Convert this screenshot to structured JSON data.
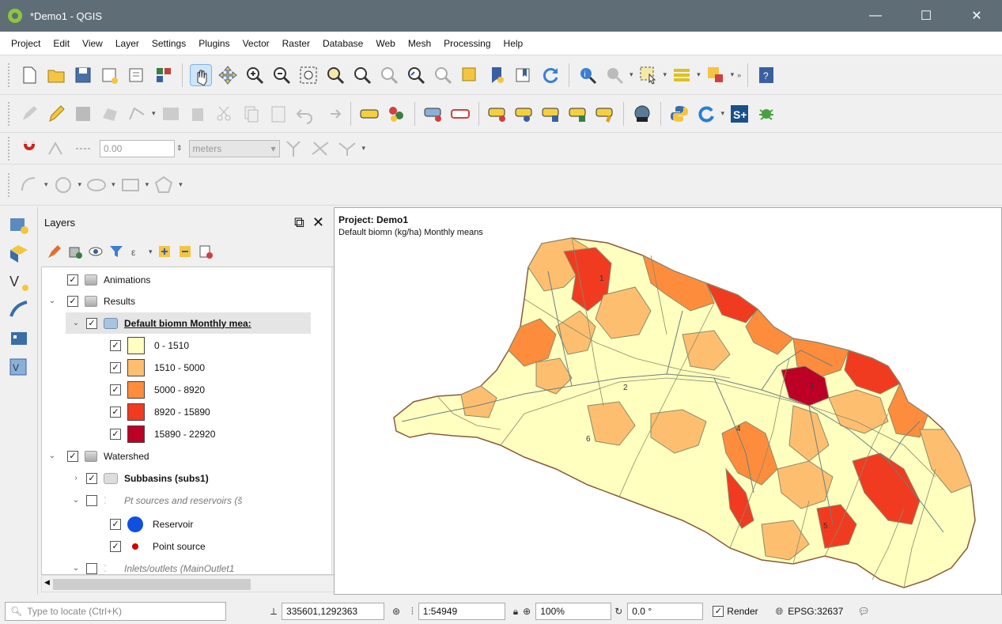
{
  "window": {
    "title": "*Demo1 - QGIS",
    "controls": [
      "—",
      "☐",
      "✕"
    ]
  },
  "menu": [
    "Project",
    "Edit",
    "View",
    "Layer",
    "Settings",
    "Plugins",
    "Vector",
    "Raster",
    "Database",
    "Web",
    "Mesh",
    "Processing",
    "Help"
  ],
  "snapping": {
    "tolerance": "0.00",
    "units": "meters"
  },
  "layers_panel": {
    "title": "Layers",
    "items": [
      {
        "label": "Animations"
      },
      {
        "label": "Results"
      },
      {
        "label": "Default biomn Monthly mea:"
      },
      {
        "label": "0 - 1510",
        "color": "#ffffbf"
      },
      {
        "label": "1510 - 5000",
        "color": "#fdbf6f"
      },
      {
        "label": "5000 - 8920",
        "color": "#fd8d3c"
      },
      {
        "label": "8920 - 15890",
        "color": "#f03b20"
      },
      {
        "label": "15890 - 22920",
        "color": "#bd0026"
      },
      {
        "label": "Watershed"
      },
      {
        "label": "Subbasins (subs1)"
      },
      {
        "label": "Pt sources and reservoirs (š"
      },
      {
        "label": "Reservoir"
      },
      {
        "label": "Point source"
      },
      {
        "label": "Inlets/outlets (MainOutlet1"
      }
    ]
  },
  "map": {
    "project_title": "Project: Demo1",
    "subtitle": "Default biomn (kg/ha) Monthly means",
    "subbasin_labels": [
      "1",
      "2",
      "3",
      "4",
      "5",
      "6"
    ]
  },
  "statusbar": {
    "locate_placeholder": "Type to locate (Ctrl+K)",
    "coordinate": "335601,1292363",
    "scale": "1:54949",
    "magnifier_label": "⊕",
    "magnifier": "100%",
    "rotation_label": "↻",
    "rotation": "0.0 °",
    "render_label": "Render",
    "crs": "EPSG:32637"
  },
  "colors": {
    "accent": "#5f6e76",
    "class1": "#ffffbf",
    "class2": "#fdbf6f",
    "class3": "#fd8d3c",
    "class4": "#f03b20",
    "class5": "#bd0026",
    "boundary": "#8a8a6a"
  }
}
